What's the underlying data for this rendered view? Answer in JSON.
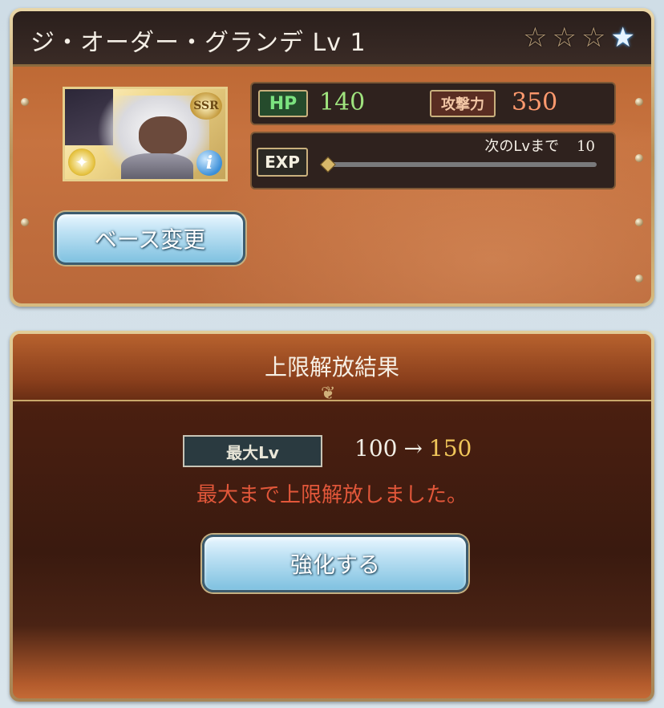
{
  "character": {
    "name_level": "ジ・オーダー・グランデ Lv 1",
    "rarity_badge": "SSR",
    "stars": [
      "☆",
      "☆",
      "☆",
      "★"
    ],
    "star_marks": [
      "1",
      "1",
      "1",
      "4"
    ]
  },
  "stats": {
    "hp_label": "HP",
    "hp_value": "140",
    "atk_label": "攻撃力",
    "atk_value": "350",
    "exp_label": "EXP",
    "next_lv_label": "次のLvまで",
    "next_lv_value": "10",
    "exp_progress": 0.0
  },
  "buttons": {
    "base_change": "ベース変更",
    "enhance": "強化する"
  },
  "result": {
    "title": "上限解放結果",
    "max_lv_label": "最大Lv",
    "old_max": "100",
    "arrow": "→",
    "new_max": "150",
    "message": "最大まで上限解放しました。"
  },
  "icons": {
    "element": "light-element-icon",
    "info": "info-icon",
    "info_glyph": "i",
    "element_glyph": "✦"
  },
  "colors": {
    "hp_value": "#9fe37e",
    "atk_value": "#ff9a6e",
    "new_max": "#f0c65a",
    "message": "#e2573a"
  }
}
